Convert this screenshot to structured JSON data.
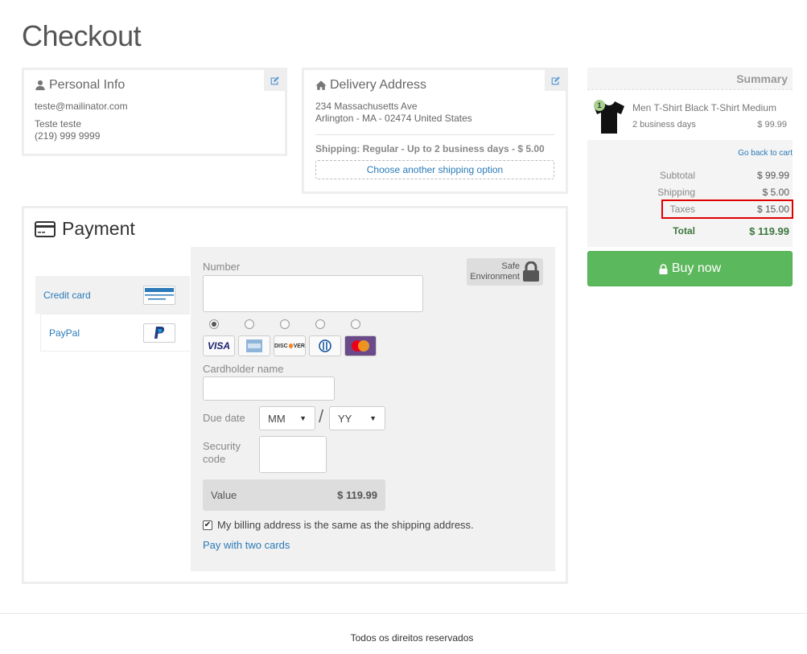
{
  "page": {
    "title": "Checkout"
  },
  "personal": {
    "heading": "Personal Info",
    "email": "teste@mailinator.com",
    "name": "Teste teste",
    "phone": "(219) 999 9999"
  },
  "delivery": {
    "heading": "Delivery Address",
    "street": "234 Massachusetts Ave",
    "city": "Arlington - MA - 02474 United States",
    "shipping": "Shipping: Regular - Up to 2 business days - $ 5.00",
    "choose_label": "Choose another shipping option"
  },
  "payment": {
    "heading": "Payment",
    "tabs": [
      {
        "label": "Credit card",
        "icon": "credit-card-icon",
        "active": true
      },
      {
        "label": "PayPal",
        "icon": "paypal-icon",
        "active": false
      }
    ],
    "safe_label_1": "Safe",
    "safe_label_2": "Environment",
    "number_label": "Number",
    "brands": [
      "VISA",
      "AMEX",
      "DISCOVER",
      "DINERS",
      "MASTERCARD"
    ],
    "brand_selected": "VISA",
    "cardholder_label": "Cardholder name",
    "due_label": "Due date",
    "month_value": "MM",
    "year_value": "YY",
    "date_separator": "/",
    "security_label_1": "Security",
    "security_label_2": "code",
    "value_label": "Value",
    "value_amount": "$ 119.99",
    "billing_same_label": "My billing address is the same as the shipping address.",
    "billing_same_checked": true,
    "two_cards_label": "Pay with two cards"
  },
  "summary": {
    "heading": "Summary",
    "item": {
      "name": "Men T-Shirt Black T-Shirt Medium",
      "delivery": "2 business days",
      "price": "$ 99.99",
      "qty_badge": "1"
    },
    "back_label": "Go back to cart",
    "subtotal_label": "Subtotal",
    "subtotal_value": "$ 99.99",
    "shipping_label": "Shipping",
    "shipping_value": "$ 5.00",
    "taxes_label": "Taxes",
    "taxes_value": "$ 15.00",
    "total_label": "Total",
    "total_value": "$ 119.99"
  },
  "buy": {
    "label": "Buy now"
  },
  "footer": {
    "text": "Todos os direitos reservados"
  },
  "colors": {
    "accent": "#2a7ab8",
    "buy_green": "#5cb85c",
    "total_green": "#3c763d",
    "highlight_red": "#e00000"
  }
}
